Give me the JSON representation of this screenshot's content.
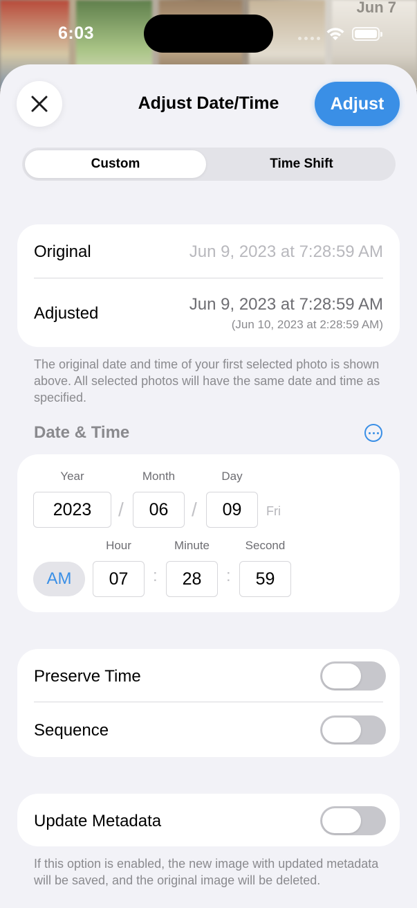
{
  "status_bar": {
    "time": "6:03"
  },
  "backdrop": {
    "date_overlay": "Jun 7"
  },
  "header": {
    "title": "Adjust Date/Time",
    "adjust_label": "Adjust"
  },
  "segments": {
    "custom": "Custom",
    "time_shift": "Time Shift",
    "selected": "Custom"
  },
  "summary": {
    "original_label": "Original",
    "original_value": "Jun 9, 2023 at 7:28:59 AM",
    "adjusted_label": "Adjusted",
    "adjusted_value": "Jun 9, 2023 at 7:28:59 AM",
    "adjusted_secondary": "(Jun 10, 2023 at 2:28:59 AM)"
  },
  "summary_footnote": "The original date and time of your first selected photo is shown above. All selected photos will have the same date and time as specified.",
  "date_time": {
    "section_title": "Date & Time",
    "year_label": "Year",
    "year": "2023",
    "month_label": "Month",
    "month": "06",
    "day_label": "Day",
    "day": "09",
    "weekday": "Fri",
    "date_separator": "/",
    "hour_label": "Hour",
    "hour": "07",
    "minute_label": "Minute",
    "minute": "28",
    "second_label": "Second",
    "second": "59",
    "time_separator": ":",
    "period": "AM"
  },
  "options": {
    "preserve_time_label": "Preserve Time",
    "preserve_time_on": false,
    "sequence_label": "Sequence",
    "sequence_on": false
  },
  "metadata": {
    "update_metadata_label": "Update Metadata",
    "update_metadata_on": false,
    "footnote": "If this option is enabled, the new image with updated metadata will be saved, and the original image will be deleted."
  },
  "colors": {
    "accent": "#3a8fe6",
    "background": "#f2f2f7",
    "secondary_text": "#8a8a8e",
    "toggle_off": "#c7c7cc"
  }
}
